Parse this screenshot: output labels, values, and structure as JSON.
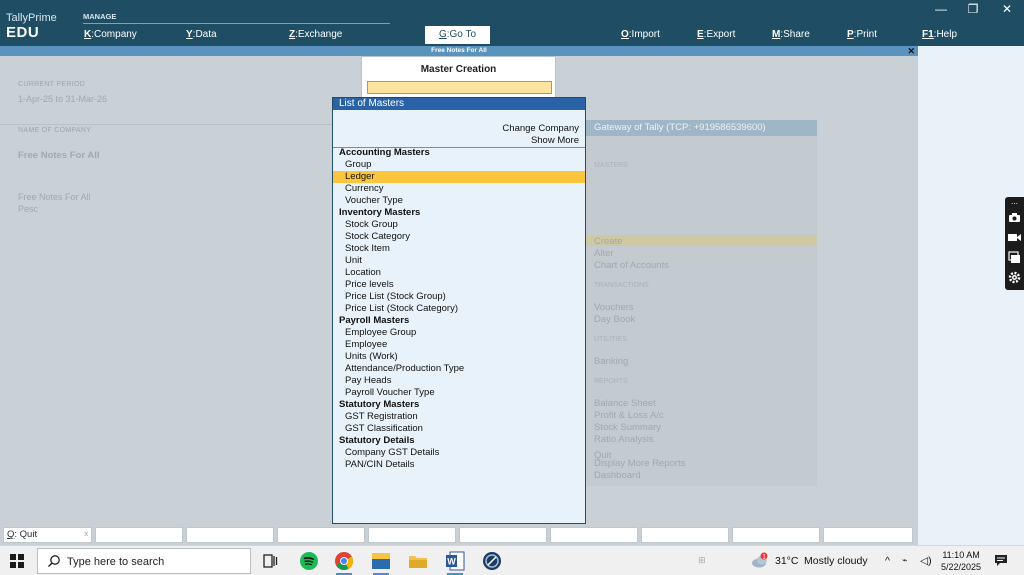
{
  "header": {
    "brand_line1": "TallyPrime",
    "brand_line2": "EDU",
    "manage_label": "MANAGE",
    "menu": [
      {
        "key": "K",
        "label": ":Company"
      },
      {
        "key": "Y",
        "label": ":Data"
      },
      {
        "key": "Z",
        "label": ":Exchange"
      },
      {
        "key": "G",
        "label": ":Go To"
      },
      {
        "key": "O",
        "label": ":Import"
      },
      {
        "key": "E",
        "label": ":Export"
      },
      {
        "key": "M",
        "label": ":Share"
      },
      {
        "key": "P",
        "label": ":Print"
      },
      {
        "key": "F1",
        "label": ":Help"
      }
    ],
    "window_controls": [
      "—",
      "❐",
      "✕"
    ]
  },
  "company_strip": {
    "title": "Free Notes For All",
    "close": "✕"
  },
  "left_panel": {
    "current_period_label": "CURRENT PERIOD",
    "current_period": "1-Apr-25 to 31-Mar-26",
    "name_of_company_label": "NAME OF COMPANY",
    "company_name": "Free Notes For All",
    "company_line1": "Free Notes For All",
    "company_line2": "Pesc"
  },
  "gateway": {
    "title": "Gateway of Tally (TCP: +919586539600)",
    "sections": [
      {
        "label": "MASTERS",
        "items": [
          "Create",
          "Alter",
          "Chart of Accounts"
        ]
      },
      {
        "label": "TRANSACTIONS",
        "items": [
          "Vouchers",
          "Day Book"
        ]
      },
      {
        "label": "UTILITIES",
        "items": [
          "Banking"
        ]
      },
      {
        "label": "REPORTS",
        "items": [
          "Balance Sheet",
          "Profit & Loss A/c",
          "Stock Summary",
          "Ratio Analysis"
        ]
      },
      {
        "label": "",
        "items": [
          "Display More Reports",
          "Dashboard"
        ]
      },
      {
        "label": "",
        "items": [
          "Quit"
        ]
      }
    ]
  },
  "master_creation": {
    "title": "Master Creation",
    "input_value": ""
  },
  "list_of_masters": {
    "title": "List of Masters",
    "change_company": "Change Company",
    "show_more": "Show More",
    "selected": "Ledger",
    "groups": [
      {
        "name": "Accounting Masters",
        "items": [
          "Group",
          "Ledger",
          "Currency",
          "Voucher Type"
        ]
      },
      {
        "name": "Inventory Masters",
        "items": [
          "Stock Group",
          "Stock Category",
          "Stock Item",
          "Unit",
          "Location",
          "Price levels",
          "Price List (Stock Group)",
          "Price List (Stock Category)"
        ]
      },
      {
        "name": "Payroll Masters",
        "items": [
          "Employee Group",
          "Employee",
          "Units (Work)",
          "Attendance/Production Type",
          "Pay Heads",
          "Payroll Voucher Type"
        ]
      },
      {
        "name": "Statutory Masters",
        "items": [
          "GST Registration",
          "GST Classification"
        ]
      },
      {
        "name": "Statutory Details",
        "items": [
          "Company GST Details",
          "PAN/CIN Details"
        ]
      }
    ]
  },
  "function_bar": {
    "quit_key": "Q",
    "quit_label": ": Quit",
    "close": "x"
  },
  "taskbar": {
    "search_placeholder": "Type here to search",
    "weather_temp": "31°C",
    "weather_desc": "Mostly cloudy",
    "weather_badge": "1",
    "time": "11:10 AM",
    "date": "5/22/2025"
  },
  "colors": {
    "header_bg": "#1f4d63",
    "list_header": "#2a62a8",
    "selection": "#fbc63d",
    "input_bg": "#fde5a0"
  }
}
